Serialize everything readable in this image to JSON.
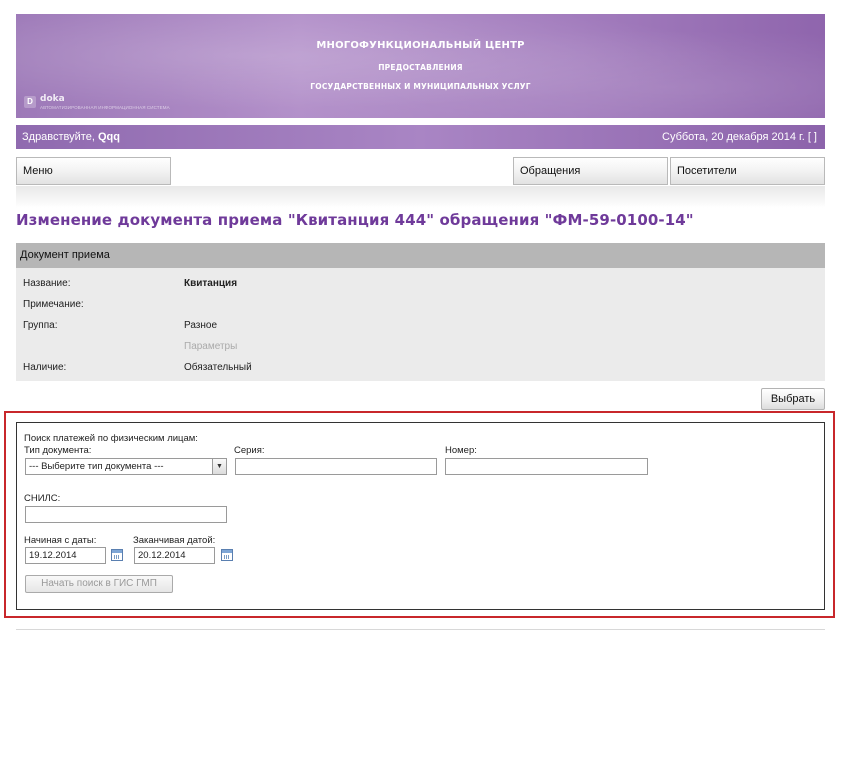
{
  "header": {
    "title_line1": "МНОГОФУНКЦИОНАЛЬНЫЙ ЦЕНТР",
    "title_line2": "ПРЕДОСТАВЛЕНИЯ",
    "title_line3": "ГОСУДАРСТВЕННЫХ И МУНИЦИПАЛЬНЫХ УСЛУГ",
    "logo_text": "doka",
    "logo_sub": "АВТОМАТИЗИРОВАННАЯ ИНФОРМАЦИОННАЯ СИСТЕМА"
  },
  "greeting": {
    "hello": "Здравствуйте, ",
    "user": "Qqq",
    "date": "Суббота, 20 декабря 2014 г. [ ]"
  },
  "menu": {
    "menu_label": "Меню",
    "appeals_label": "Обращения",
    "visitors_label": "Посетители"
  },
  "page": {
    "title": "Изменение документа приема \"Квитанция 444\" обращения \"ФМ-59-0100-14\""
  },
  "document": {
    "header": "Документ приема",
    "rows": [
      {
        "label": "Название:",
        "value": "Квитанция"
      },
      {
        "label": "Примечание:",
        "value": ""
      },
      {
        "label": "Группа:",
        "value": "Разное"
      },
      {
        "label": "",
        "value": "Параметры"
      },
      {
        "label": "Наличие:",
        "value": "Обязательный"
      }
    ],
    "choose_label": "Выбрать"
  },
  "search_form": {
    "heading": "Поиск платежей по физическим лицам:",
    "doc_type_label": "Тип документа:",
    "doc_type_selected": "--- Выберите тип документа ---",
    "series_label": "Серия:",
    "series_value": "",
    "number_label": "Номер:",
    "number_value": "",
    "snils_label": "СНИЛС:",
    "snils_value": "",
    "from_label": "Начиная с даты:",
    "from_value": "19.12.2014",
    "to_label": "Заканчивая датой:",
    "to_value": "20.12.2014",
    "search_button": "Начать поиск в ГИС ГМП"
  },
  "colors": {
    "banner": "#a27cbd",
    "title_purple": "#6f3a9a",
    "highlight_red": "#c8272b"
  }
}
